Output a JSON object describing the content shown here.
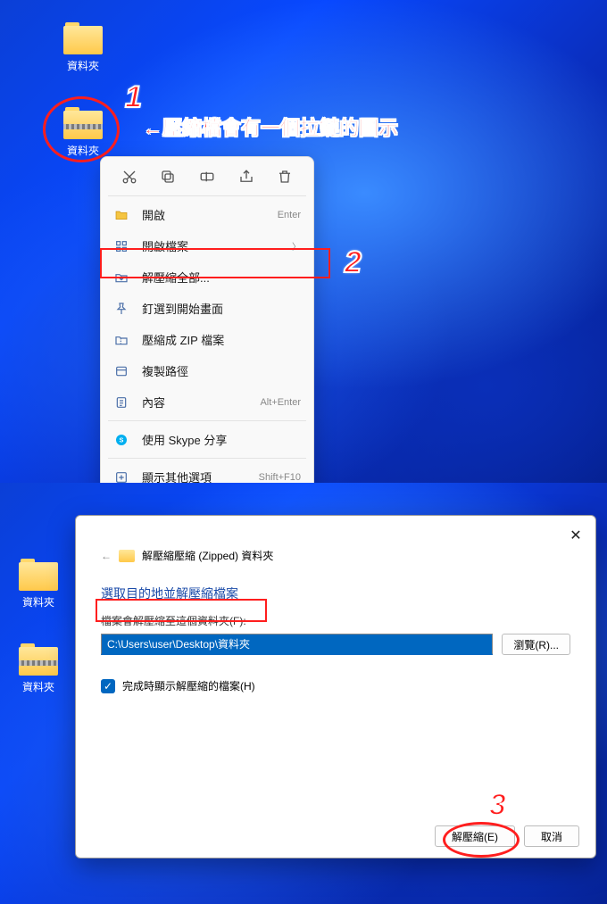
{
  "top": {
    "icons": {
      "folder": "資料夾",
      "zipfolder": "資料夾"
    },
    "anno": {
      "num1": "1",
      "num2": "2",
      "arrowText": "←壓縮檔會有一個拉鏈的圖示"
    },
    "ctx": {
      "toolbar": [
        "cut",
        "copy",
        "rename",
        "share",
        "delete"
      ],
      "open": "開啟",
      "open_sc": "Enter",
      "openwith": "開啟檔案",
      "extract": "解壓縮全部...",
      "pin": "釘選到開始畫面",
      "compress": "壓縮成 ZIP 檔案",
      "copypath": "複製路徑",
      "properties": "內容",
      "properties_sc": "Alt+Enter",
      "skype": "使用 Skype 分享",
      "more": "顯示其他選項",
      "more_sc": "Shift+F10"
    }
  },
  "bottom": {
    "icons": {
      "folder": "資料夾",
      "zipfolder": "資料夾"
    },
    "anno": {
      "num3": "3"
    },
    "dlg": {
      "header": "解壓縮壓縮 (Zipped) 資料夾",
      "title": "選取目的地並解壓縮檔案",
      "destlabel": "檔案會解壓縮至這個資料夾(F):",
      "path": "C:\\Users\\user\\Desktop\\資料夾",
      "browse": "瀏覽(R)...",
      "show": "完成時顯示解壓縮的檔案(H)",
      "extract": "解壓縮(E)",
      "cancel": "取消"
    }
  }
}
